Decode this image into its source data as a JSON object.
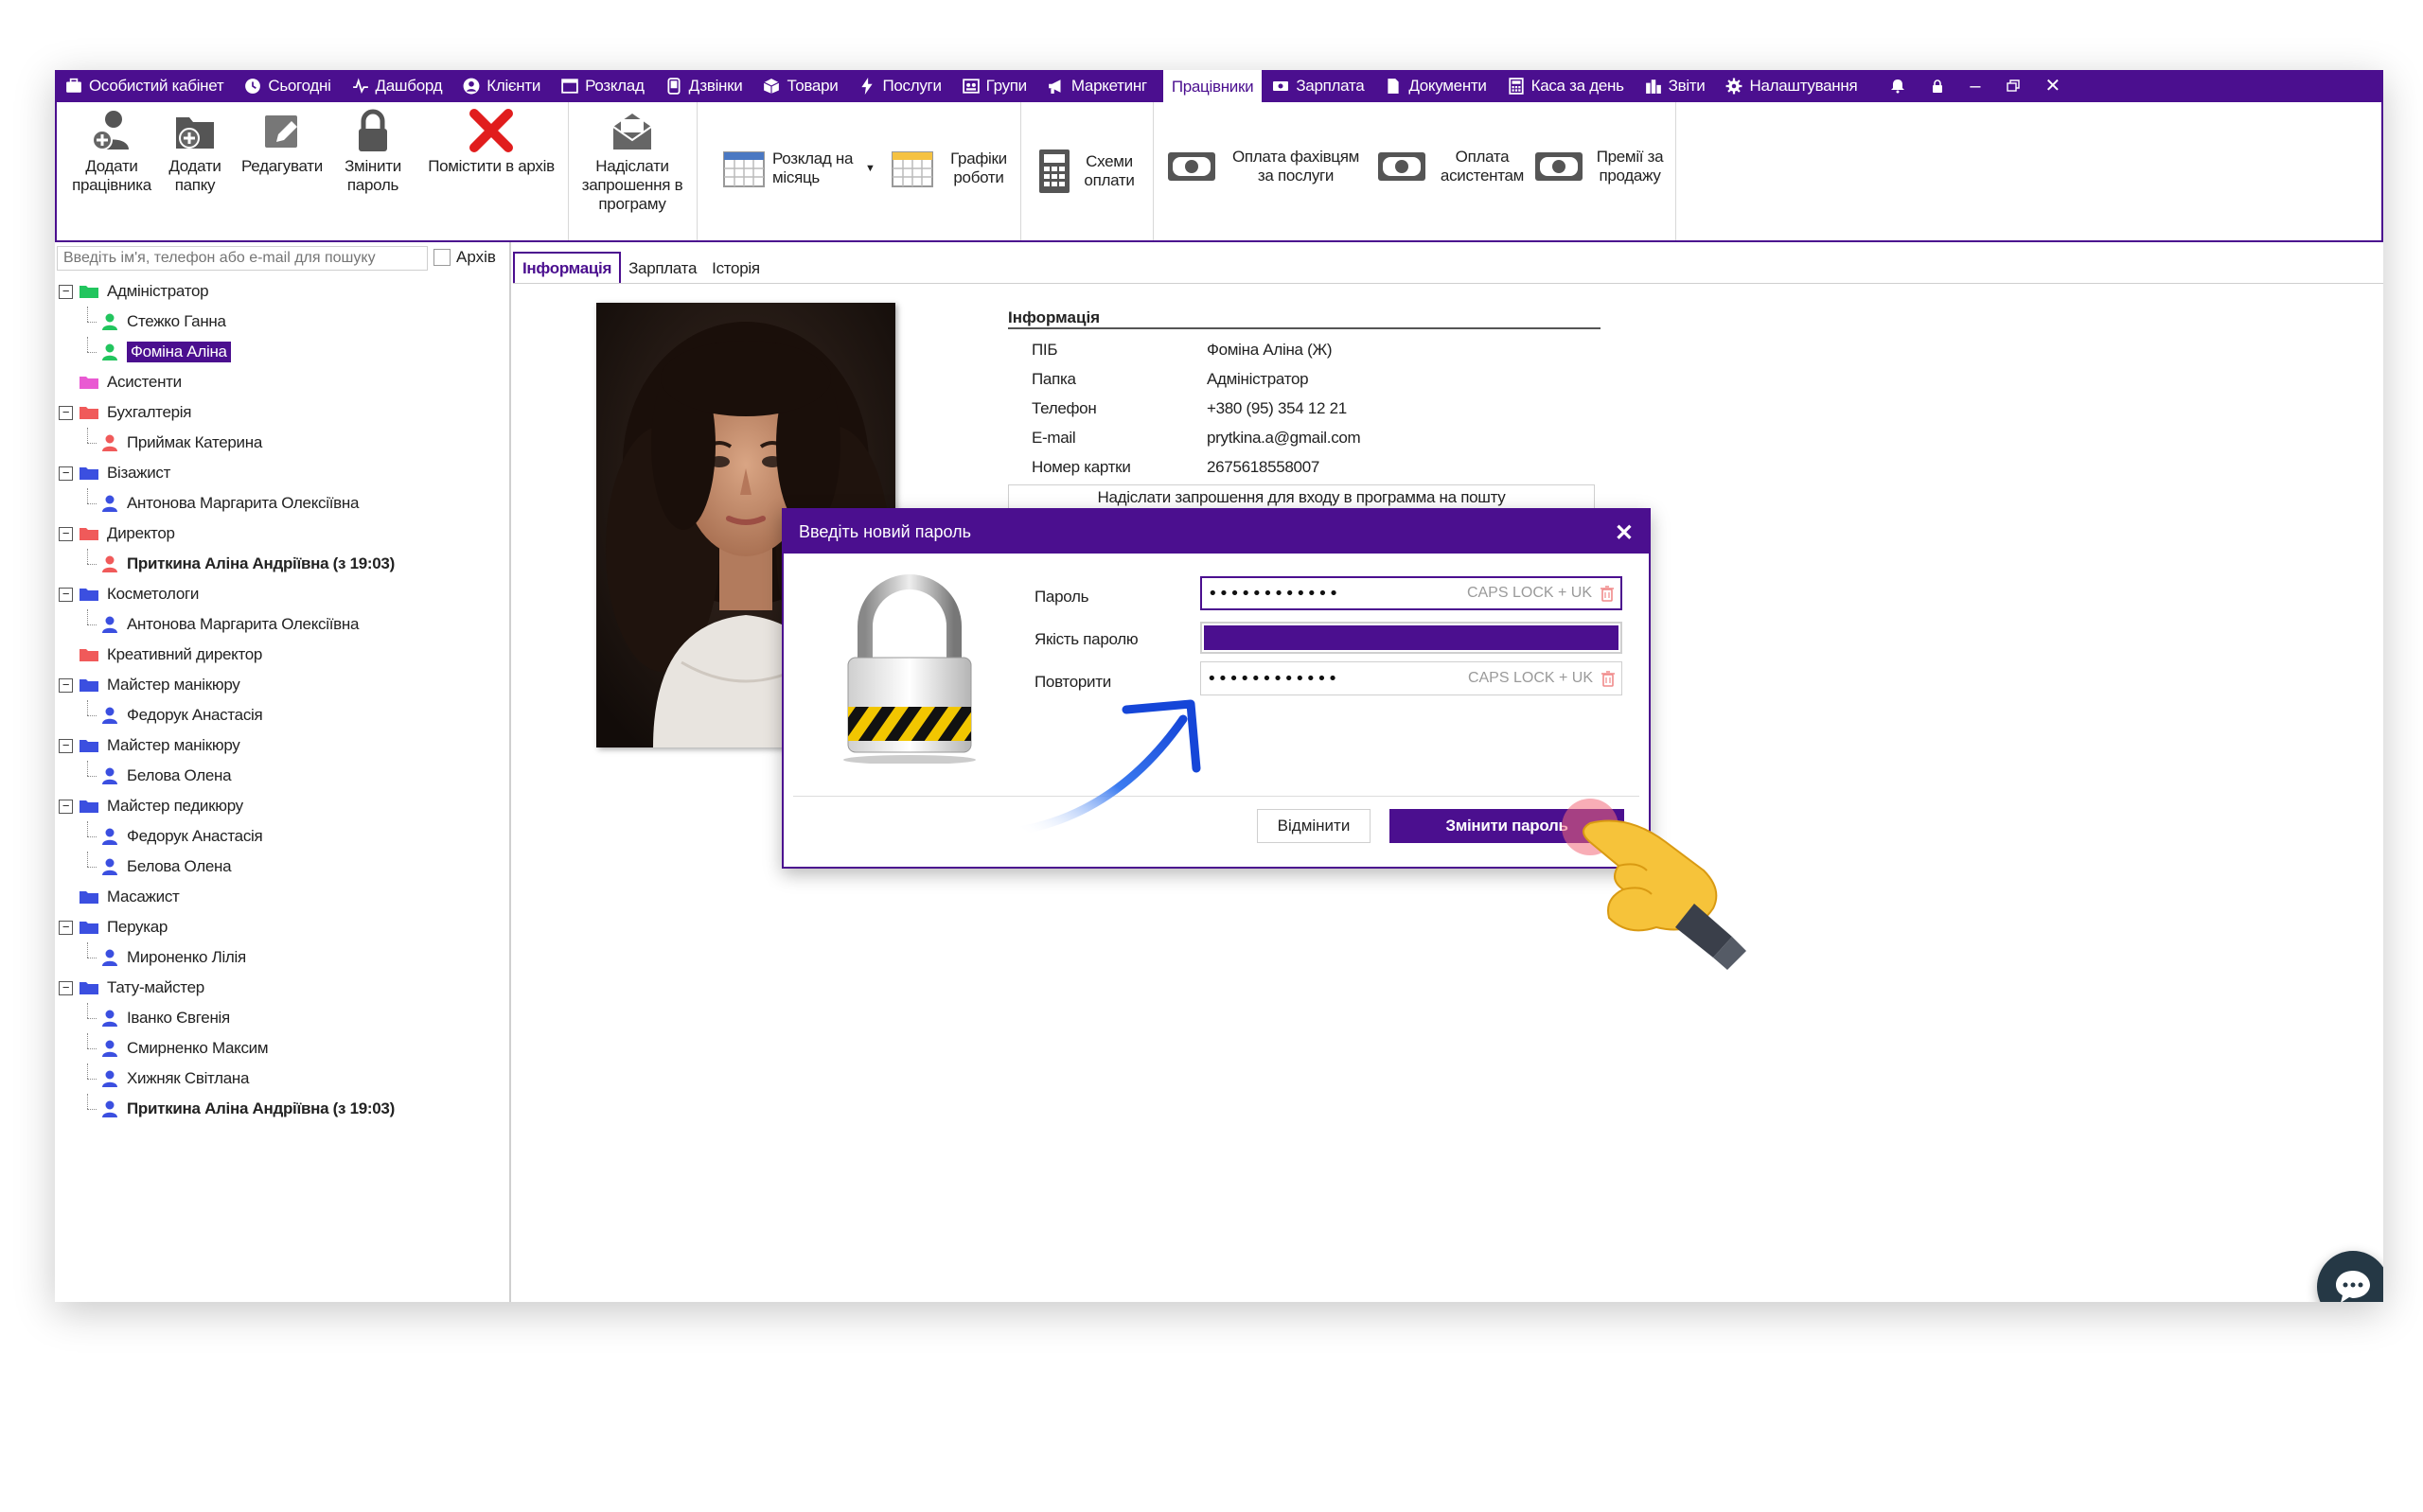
{
  "topmenu": {
    "items": [
      {
        "label": "Особистий кабінет",
        "icon": "cabinet-icon"
      },
      {
        "label": "Сьогодні",
        "icon": "clock-icon"
      },
      {
        "label": "Дашборд",
        "icon": "pulse-icon"
      },
      {
        "label": "Клієнти",
        "icon": "user-icon"
      },
      {
        "label": "Розклад",
        "icon": "calendar-icon"
      },
      {
        "label": "Дзвінки",
        "icon": "phone-icon"
      },
      {
        "label": "Товари",
        "icon": "box-icon"
      },
      {
        "label": "Послуги",
        "icon": "bolt-icon"
      },
      {
        "label": "Групи",
        "icon": "groups-icon"
      },
      {
        "label": "Маркетинг",
        "icon": "megaphone-icon"
      },
      {
        "label": "Працівники",
        "icon": ""
      },
      {
        "label": "Зарплата",
        "icon": "money-icon"
      },
      {
        "label": "Документи",
        "icon": "document-icon"
      },
      {
        "label": "Каса за день",
        "icon": "calculator-icon"
      },
      {
        "label": "Звіти",
        "icon": "bars-icon"
      },
      {
        "label": "Налаштування",
        "icon": "gear-icon"
      }
    ],
    "active": "Працівники"
  },
  "ribbon": {
    "add_employee": "Додати працівника",
    "add_folder": "Додати папку",
    "edit": "Редагувати",
    "change_password": "Змінити пароль",
    "archive": "Помістити в архів",
    "send_invite": "Надіслати запрошення в програму",
    "monthly_schedule": "Розклад на місяць",
    "work_schedules": "Графіки роботи",
    "payment_schemes": "Схеми оплати",
    "pay_specialists": "Оплата фахівцям за послуги",
    "pay_assistants": "Оплата асистентам",
    "sales_bonuses": "Премії за продажу"
  },
  "left": {
    "search_placeholder": "Введіть ім'я, телефон або e-mail для пошуку",
    "archive_label": "Архів",
    "tree": [
      {
        "type": "folder",
        "label": "Адміністратор",
        "color": "#22c55e",
        "expand": true
      },
      {
        "type": "person",
        "label": "Стежко Ганна",
        "color": "#22c55e"
      },
      {
        "type": "person",
        "label": "Фоміна Аліна",
        "color": "#22c55e",
        "selected": true
      },
      {
        "type": "folder",
        "label": "Асистенти",
        "color": "#e95ad2",
        "expand": false
      },
      {
        "type": "folder",
        "label": "Бухгалтерія",
        "color": "#f05a5a",
        "expand": true
      },
      {
        "type": "person",
        "label": "Приймак Катерина",
        "color": "#f05a5a"
      },
      {
        "type": "folder",
        "label": "Візажист",
        "color": "#3b4fe0",
        "expand": true
      },
      {
        "type": "person",
        "label": "Антонова Маргарита Олексіївна",
        "color": "#3b4fe0"
      },
      {
        "type": "folder",
        "label": "Директор",
        "color": "#f05a5a",
        "expand": true
      },
      {
        "type": "person",
        "label": "Приткина Аліна Андріївна (з 19:03)",
        "color": "#f05a5a",
        "bold": true
      },
      {
        "type": "folder",
        "label": "Косметологи",
        "color": "#3b4fe0",
        "expand": true
      },
      {
        "type": "person",
        "label": "Антонова Маргарита Олексіївна",
        "color": "#3b4fe0"
      },
      {
        "type": "folder",
        "label": "Креативний директор",
        "color": "#f05a5a",
        "expand": false
      },
      {
        "type": "folder",
        "label": "Майстер манікюру",
        "color": "#3b4fe0",
        "expand": true
      },
      {
        "type": "person",
        "label": "Федорук Анастасія",
        "color": "#3b4fe0"
      },
      {
        "type": "folder",
        "label": "Майстер манікюру",
        "color": "#3b4fe0",
        "expand": true
      },
      {
        "type": "person",
        "label": "Белова Олена",
        "color": "#3b4fe0"
      },
      {
        "type": "folder",
        "label": "Майстер педикюру",
        "color": "#3b4fe0",
        "expand": true
      },
      {
        "type": "person",
        "label": "Федорук Анастасія",
        "color": "#3b4fe0"
      },
      {
        "type": "person",
        "label": "Белова Олена",
        "color": "#3b4fe0"
      },
      {
        "type": "folder",
        "label": "Масажист",
        "color": "#3b4fe0",
        "expand": false
      },
      {
        "type": "folder",
        "label": "Перукар",
        "color": "#3b4fe0",
        "expand": true
      },
      {
        "type": "person",
        "label": "Мироненко Лілія",
        "color": "#3b4fe0"
      },
      {
        "type": "folder",
        "label": "Тату-майстер",
        "color": "#3b4fe0",
        "expand": true
      },
      {
        "type": "person",
        "label": "Іванко Євгенія",
        "color": "#3b4fe0"
      },
      {
        "type": "person",
        "label": "Смирненко Максим",
        "color": "#3b4fe0"
      },
      {
        "type": "person",
        "label": "Хижняк Світлана",
        "color": "#3b4fe0"
      },
      {
        "type": "person",
        "label": "Приткина Аліна Андріївна (з 19:03)",
        "color": "#3b4fe0",
        "bold": true
      }
    ]
  },
  "tabs": [
    "Інформація",
    "Зарплата",
    "Історія"
  ],
  "info": {
    "title": "Інформація",
    "rows": [
      {
        "k": "ПІБ",
        "v": "Фоміна Аліна (Ж)"
      },
      {
        "k": "Папка",
        "v": "Адміністратор"
      },
      {
        "k": "Телефон",
        "v": "+380 (95) 354 12 21"
      },
      {
        "k": "E-mail",
        "v": "prytkina.a@gmail.com"
      },
      {
        "k": "Номер картки",
        "v": "2675618558007"
      }
    ],
    "invite_button": "Надіслати запрошення для входу в программа на пошту"
  },
  "dialog": {
    "title": "Введіть новий пароль",
    "password_label": "Пароль",
    "password_value": "••••••••••••",
    "caps_hint": "CAPS LOCK + UK",
    "quality_label": "Якість паролю",
    "quality_level": 1.0,
    "repeat_label": "Повторити",
    "repeat_value": "••••••••••••",
    "cancel": "Відмінити",
    "submit": "Змінити пароль"
  },
  "colors": {
    "accent": "#4b0f8f"
  }
}
